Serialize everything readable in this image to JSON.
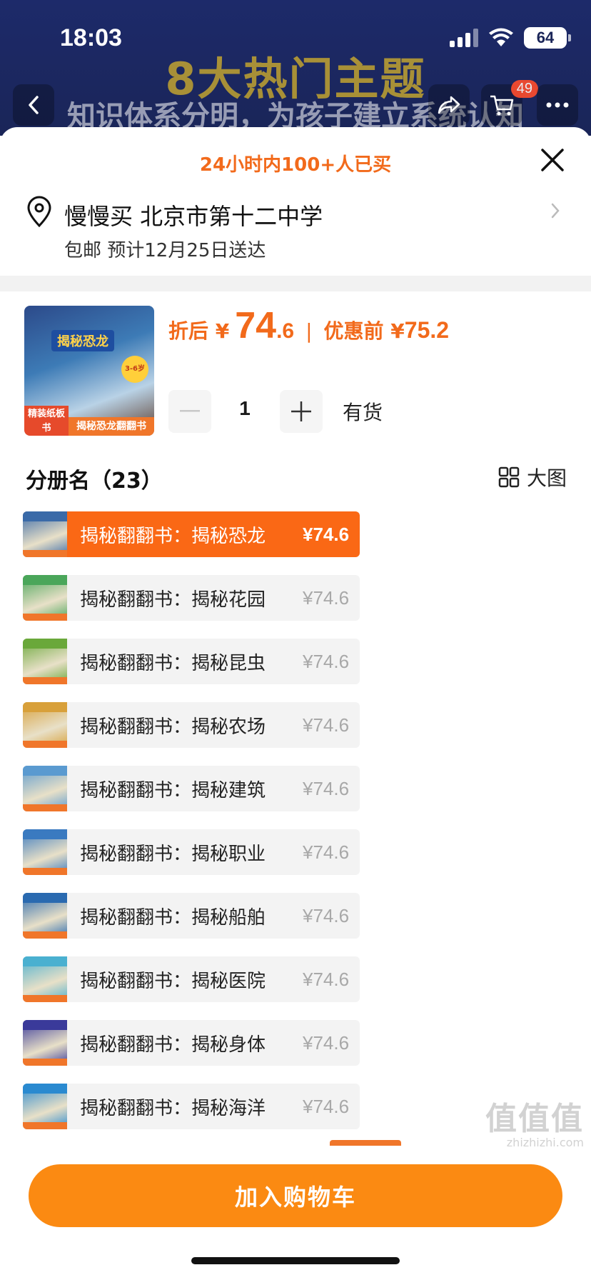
{
  "status_bar": {
    "time": "18:03",
    "battery": "64"
  },
  "banner": {
    "title": "8大热门主题",
    "subtitle": "知识体系分明，为孩子建立系统认知"
  },
  "nav": {
    "cart_badge": "49"
  },
  "sheet": {
    "sold_text": "24小时内100+人已买",
    "address": {
      "main": "慢慢买 北京市第十二中学",
      "sub": "包邮 预计12月25日送达"
    },
    "product": {
      "thumb_title": "揭秘恐龙",
      "thumb_badge": "精装纸板书",
      "thumb_strip": "揭秘恐龙翻翻书",
      "thumb_age": "3-6岁",
      "price_label": "折后 ¥",
      "price_int": "74",
      "price_dec": ".6",
      "price_sep": "|",
      "orig_label": "优惠前 ¥",
      "orig_price": "75.2",
      "quantity": "1",
      "stock": "有货"
    },
    "section_title": "分册名（23）",
    "view_big_label": "大图",
    "options": [
      {
        "name": "揭秘翻翻书：揭秘恐龙",
        "price": "¥74.6",
        "selected": true,
        "color": "#3a6aa8"
      },
      {
        "name": "揭秘翻翻书：揭秘花园",
        "price": "¥74.6",
        "selected": false,
        "color": "#4aa65a"
      },
      {
        "name": "揭秘翻翻书：揭秘昆虫",
        "price": "¥74.6",
        "selected": false,
        "color": "#6aa83a"
      },
      {
        "name": "揭秘翻翻书：揭秘农场",
        "price": "¥74.6",
        "selected": false,
        "color": "#d8a03a"
      },
      {
        "name": "揭秘翻翻书：揭秘建筑",
        "price": "¥74.6",
        "selected": false,
        "color": "#5a9ad0"
      },
      {
        "name": "揭秘翻翻书：揭秘职业",
        "price": "¥74.6",
        "selected": false,
        "color": "#3a7ac0"
      },
      {
        "name": "揭秘翻翻书：揭秘船舶",
        "price": "¥74.6",
        "selected": false,
        "color": "#2a6ab0"
      },
      {
        "name": "揭秘翻翻书：揭秘医院",
        "price": "¥74.6",
        "selected": false,
        "color": "#4ab0d0"
      },
      {
        "name": "揭秘翻翻书：揭秘身体",
        "price": "¥74.6",
        "selected": false,
        "color": "#3a3a9a"
      },
      {
        "name": "揭秘翻翻书：揭秘海洋",
        "price": "¥74.6",
        "selected": false,
        "color": "#2a8ad0"
      }
    ],
    "add_to_cart": "加入购物车"
  },
  "watermark": {
    "big": "值值值",
    "small": "zhizhizhi.com"
  },
  "colors": {
    "accent": "#f26a1b",
    "selected_bg": "#fa6815",
    "cart_button": "#fb8a12",
    "banner_bg": "#1d2a6a"
  }
}
